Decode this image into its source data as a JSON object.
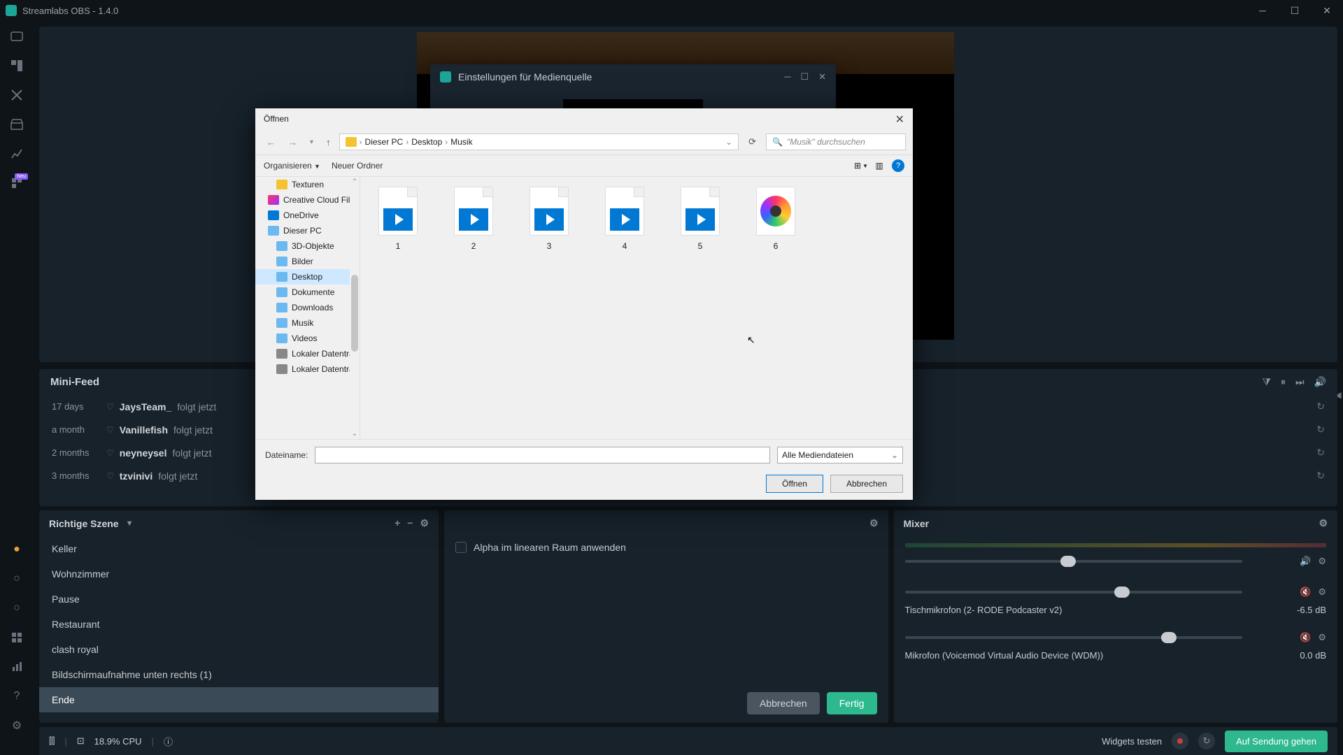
{
  "titlebar": {
    "title": "Streamlabs OBS - 1.4.0"
  },
  "leftrail": {
    "badge": "Neu"
  },
  "settings_window": {
    "title": "Einstellungen für Medienquelle"
  },
  "file_dialog": {
    "title": "Öffnen",
    "breadcrumb": [
      "Dieser PC",
      "Desktop",
      "Musik"
    ],
    "search_placeholder": "\"Musik\" durchsuchen",
    "toolbar": {
      "organize": "Organisieren",
      "new_folder": "Neuer Ordner"
    },
    "tree": {
      "items": [
        {
          "label": "Texturen",
          "icon": "folder-y",
          "level": 1
        },
        {
          "label": "Creative Cloud Fil",
          "icon": "cc",
          "level": 0
        },
        {
          "label": "OneDrive",
          "icon": "od",
          "level": 0
        },
        {
          "label": "Dieser PC",
          "icon": "pc",
          "level": 0
        },
        {
          "label": "3D-Objekte",
          "icon": "folder",
          "level": 1
        },
        {
          "label": "Bilder",
          "icon": "folder",
          "level": 1
        },
        {
          "label": "Desktop",
          "icon": "folder",
          "level": 1,
          "selected": true
        },
        {
          "label": "Dokumente",
          "icon": "folder",
          "level": 1
        },
        {
          "label": "Downloads",
          "icon": "folder",
          "level": 1
        },
        {
          "label": "Musik",
          "icon": "folder",
          "level": 1
        },
        {
          "label": "Videos",
          "icon": "folder",
          "level": 1
        },
        {
          "label": "Lokaler Datentra",
          "icon": "drive",
          "level": 1
        },
        {
          "label": "Lokaler Datentra",
          "icon": "drive",
          "level": 1
        }
      ]
    },
    "files": [
      {
        "name": "1",
        "type": "video"
      },
      {
        "name": "2",
        "type": "video"
      },
      {
        "name": "3",
        "type": "video"
      },
      {
        "name": "4",
        "type": "video"
      },
      {
        "name": "5",
        "type": "video"
      },
      {
        "name": "6",
        "type": "music"
      }
    ],
    "footer": {
      "filename_label": "Dateiname:",
      "filetype": "Alle Mediendateien",
      "open": "Öffnen",
      "cancel": "Abbrechen"
    }
  },
  "minifeed": {
    "title": "Mini-Feed",
    "rows": [
      {
        "age": "17 days",
        "user": "JaysTeam_",
        "action": "folgt jetzt"
      },
      {
        "age": "a month",
        "user": "Vanillefish",
        "action": "folgt jetzt"
      },
      {
        "age": "2 months",
        "user": "neyneysel",
        "action": "folgt jetzt"
      },
      {
        "age": "3 months",
        "user": "tzvinivi",
        "action": "folgt jetzt"
      }
    ]
  },
  "scenes": {
    "title": "Richtige Szene",
    "items": [
      {
        "label": "Keller"
      },
      {
        "label": "Wohnzimmer"
      },
      {
        "label": "Pause"
      },
      {
        "label": "Restaurant"
      },
      {
        "label": "clash royal"
      },
      {
        "label": "Bildschirmaufnahme unten rechts (1)"
      },
      {
        "label": "Ende",
        "active": true
      }
    ]
  },
  "sources": {
    "alpha_label": "Alpha im linearen Raum anwenden",
    "cancel": "Abbrechen",
    "done": "Fertig"
  },
  "mixer": {
    "title": "Mixer",
    "tracks": [
      {
        "name": "",
        "db": "",
        "knob": 46,
        "muted": false
      },
      {
        "name": "Tischmikrofon (2- RODE Podcaster v2)",
        "db": "-6.5 dB",
        "knob": 62,
        "muted": true
      },
      {
        "name": "Mikrofon (Voicemod Virtual Audio Device (WDM))",
        "db": "0.0 dB",
        "knob": 76,
        "muted": true
      }
    ]
  },
  "statusbar": {
    "cpu": "18.9% CPU",
    "widgets": "Widgets testen",
    "go_live": "Auf Sendung gehen"
  }
}
